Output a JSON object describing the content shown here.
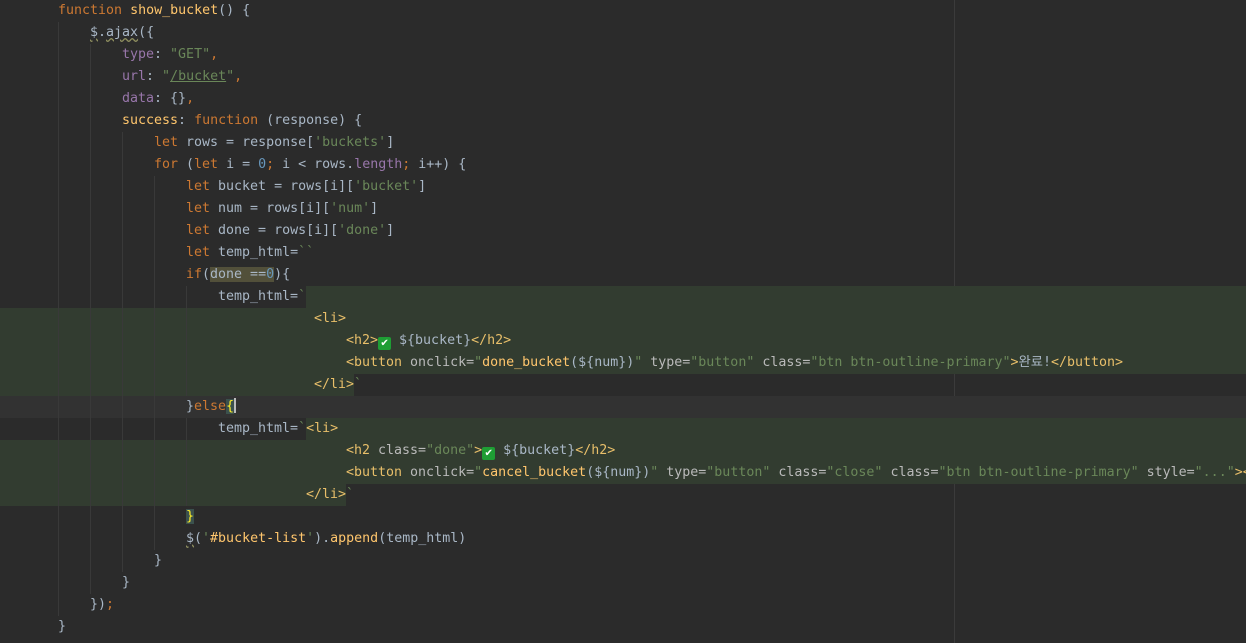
{
  "editor": {
    "lines": [
      {
        "indent": 58,
        "guides": [],
        "tokens": [
          [
            "kw",
            "function "
          ],
          [
            "fn",
            "show_bucket"
          ],
          [
            "plain",
            "() {"
          ]
        ]
      },
      {
        "indent": 90,
        "guides": [
          58
        ],
        "tokens": [
          [
            "squig",
            "$"
          ],
          [
            "plain",
            "."
          ],
          [
            "squig",
            "ajax"
          ],
          [
            "plain",
            "({"
          ]
        ]
      },
      {
        "indent": 122,
        "guides": [
          58,
          90
        ],
        "tokens": [
          [
            "prop",
            "type"
          ],
          [
            "plain",
            ": "
          ],
          [
            "str",
            "\"GET\""
          ],
          [
            "kw",
            ","
          ]
        ]
      },
      {
        "indent": 122,
        "guides": [
          58,
          90
        ],
        "tokens": [
          [
            "prop",
            "url"
          ],
          [
            "plain",
            ": "
          ],
          [
            "str",
            "\""
          ],
          [
            "str-u",
            "/bucket"
          ],
          [
            "str",
            "\""
          ],
          [
            "kw",
            ","
          ]
        ]
      },
      {
        "indent": 122,
        "guides": [
          58,
          90
        ],
        "tokens": [
          [
            "prop",
            "data"
          ],
          [
            "plain",
            ": {}"
          ],
          [
            "kw",
            ","
          ]
        ]
      },
      {
        "indent": 122,
        "guides": [
          58,
          90
        ],
        "tokens": [
          [
            "fn",
            "success"
          ],
          [
            "plain",
            ": "
          ],
          [
            "kw",
            "function "
          ],
          [
            "plain",
            "(response) {"
          ]
        ]
      },
      {
        "indent": 154,
        "guides": [
          58,
          90,
          122
        ],
        "tokens": [
          [
            "kw",
            "let "
          ],
          [
            "plain",
            "rows = response["
          ],
          [
            "str",
            "'buckets'"
          ],
          [
            "plain",
            "]"
          ]
        ]
      },
      {
        "indent": 154,
        "guides": [
          58,
          90,
          122
        ],
        "tokens": [
          [
            "kw",
            "for "
          ],
          [
            "plain",
            "("
          ],
          [
            "kw",
            "let "
          ],
          [
            "plain",
            "i = "
          ],
          [
            "num",
            "0"
          ],
          [
            "kw",
            "; "
          ],
          [
            "plain",
            "i < rows."
          ],
          [
            "prop",
            "length"
          ],
          [
            "kw",
            "; "
          ],
          [
            "plain",
            "i++) {"
          ]
        ]
      },
      {
        "indent": 186,
        "guides": [
          58,
          90,
          122,
          154
        ],
        "tokens": [
          [
            "kw",
            "let "
          ],
          [
            "plain",
            "bucket = rows[i]["
          ],
          [
            "str",
            "'bucket'"
          ],
          [
            "plain",
            "]"
          ]
        ]
      },
      {
        "indent": 186,
        "guides": [
          58,
          90,
          122,
          154
        ],
        "tokens": [
          [
            "kw",
            "let "
          ],
          [
            "plain",
            "num = rows[i]["
          ],
          [
            "str",
            "'num'"
          ],
          [
            "plain",
            "]"
          ]
        ]
      },
      {
        "indent": 186,
        "guides": [
          58,
          90,
          122,
          154
        ],
        "tokens": [
          [
            "kw",
            "let "
          ],
          [
            "plain",
            "done = rows[i]["
          ],
          [
            "str",
            "'done'"
          ],
          [
            "plain",
            "]"
          ]
        ]
      },
      {
        "indent": 186,
        "guides": [
          58,
          90,
          122,
          154
        ],
        "tokens": [
          [
            "kw",
            "let "
          ],
          [
            "plain",
            "temp_html="
          ],
          [
            "str",
            "``"
          ]
        ]
      },
      {
        "indent": 186,
        "guides": [
          58,
          90,
          122,
          154
        ],
        "tokens": [
          [
            "kw",
            "if"
          ],
          [
            "plain",
            "("
          ],
          [
            "hl",
            "done =="
          ],
          [
            "hlnum",
            "0"
          ],
          [
            "plain",
            "){"
          ]
        ]
      },
      {
        "indent": 218,
        "guides": [
          58,
          90,
          122,
          154,
          186
        ],
        "bg": "green-right",
        "tokens": [
          [
            "plain",
            "temp_html="
          ],
          [
            "str",
            "`"
          ]
        ]
      },
      {
        "indent": 314,
        "guides": [
          58,
          90,
          122,
          154,
          186
        ],
        "bg": "green",
        "tokens": [
          [
            "tag",
            "<li>"
          ]
        ]
      },
      {
        "indent": 346,
        "guides": [
          58,
          90,
          122,
          154,
          186
        ],
        "bg": "green",
        "tokens": [
          [
            "tag",
            "<h2>"
          ],
          [
            "check",
            "✔"
          ],
          [
            "plain",
            " ${bucket}"
          ],
          [
            "tag",
            "</h2>"
          ]
        ]
      },
      {
        "indent": 346,
        "guides": [
          58,
          90,
          122,
          154,
          186
        ],
        "bg": "green",
        "tokens": [
          [
            "tag",
            "<button "
          ],
          [
            "attr",
            "onclick="
          ],
          [
            "str",
            "\""
          ],
          [
            "fn",
            "done_bucket"
          ],
          [
            "plain",
            "(${num})"
          ],
          [
            "str",
            "\""
          ],
          [
            "attr",
            " type="
          ],
          [
            "str",
            "\"button\""
          ],
          [
            "attr",
            " class="
          ],
          [
            "str",
            "\"btn btn-outline-primary\""
          ],
          [
            "tag",
            ">"
          ],
          [
            "plain",
            "완료!"
          ],
          [
            "tag",
            "</button>"
          ]
        ]
      },
      {
        "indent": 314,
        "guides": [
          58,
          90,
          122,
          154,
          186
        ],
        "bg": "green-left",
        "tokens": [
          [
            "tag",
            "</li>"
          ],
          [
            "str",
            "`"
          ]
        ]
      },
      {
        "indent": 186,
        "guides": [
          58,
          90,
          122,
          154
        ],
        "bg": "cur",
        "tokens": [
          [
            "plain",
            "}"
          ],
          [
            "kw",
            "else"
          ],
          [
            "brace",
            "{"
          ],
          [
            "caret",
            ""
          ]
        ]
      },
      {
        "indent": 218,
        "guides": [
          58,
          90,
          122,
          154,
          186
        ],
        "bg": "green-right2",
        "tokens": [
          [
            "plain",
            "temp_html="
          ],
          [
            "str",
            "`"
          ],
          [
            "tag",
            "<li>"
          ]
        ]
      },
      {
        "indent": 346,
        "guides": [
          58,
          90,
          122,
          154,
          186
        ],
        "bg": "green",
        "tokens": [
          [
            "tag",
            "<h2 "
          ],
          [
            "attr",
            "class="
          ],
          [
            "str",
            "\"done\""
          ],
          [
            "tag",
            ">"
          ],
          [
            "check",
            "✔"
          ],
          [
            "plain",
            " ${bucket}"
          ],
          [
            "tag",
            "</h2>"
          ]
        ]
      },
      {
        "indent": 346,
        "guides": [
          58,
          90,
          122,
          154,
          186
        ],
        "bg": "green",
        "tokens": [
          [
            "tag",
            "<button "
          ],
          [
            "attr",
            "onclick="
          ],
          [
            "str",
            "\""
          ],
          [
            "fn",
            "cancel_bucket"
          ],
          [
            "plain",
            "(${num})"
          ],
          [
            "str",
            "\""
          ],
          [
            "attr",
            " type="
          ],
          [
            "str",
            "\"button\""
          ],
          [
            "attr",
            " class="
          ],
          [
            "str",
            "\"close\""
          ],
          [
            "attr",
            " class="
          ],
          [
            "str",
            "\"btn btn-outline-primary\""
          ],
          [
            "attr",
            " style="
          ],
          [
            "str",
            "\"...\""
          ],
          [
            "tag",
            ">&lt;"
          ]
        ]
      },
      {
        "indent": 306,
        "guides": [
          58,
          90,
          122,
          154,
          186
        ],
        "bg": "green-left",
        "tokens": [
          [
            "tag",
            "</li>"
          ],
          [
            "str",
            "`"
          ]
        ]
      },
      {
        "indent": 186,
        "guides": [
          58,
          90,
          122,
          154
        ],
        "tokens": [
          [
            "brace",
            "}"
          ]
        ]
      },
      {
        "indent": 186,
        "guides": [
          58,
          90,
          122,
          154
        ],
        "tokens": [
          [
            "squig",
            "$"
          ],
          [
            "plain",
            "("
          ],
          [
            "str",
            "'"
          ],
          [
            "fn",
            "#bucket-list"
          ],
          [
            "str",
            "'"
          ],
          [
            "plain",
            ")."
          ],
          [
            "fn",
            "append"
          ],
          [
            "plain",
            "(temp_html)"
          ]
        ]
      },
      {
        "indent": 154,
        "guides": [
          58,
          90,
          122
        ],
        "tokens": [
          [
            "plain",
            "}"
          ]
        ]
      },
      {
        "indent": 122,
        "guides": [
          58,
          90
        ],
        "tokens": [
          [
            "plain",
            "}"
          ]
        ]
      },
      {
        "indent": 90,
        "guides": [
          58
        ],
        "tokens": [
          [
            "plain",
            "})"
          ],
          [
            "kw",
            ";"
          ]
        ]
      },
      {
        "indent": 58,
        "guides": [],
        "tokens": [
          [
            "plain",
            "}"
          ]
        ]
      }
    ],
    "gutter_icon": "lightbulb-icon"
  }
}
